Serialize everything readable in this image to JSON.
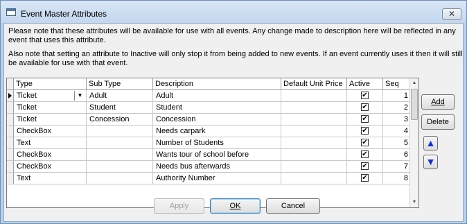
{
  "window": {
    "title": "Event Master Attributes",
    "close_glyph": "✕",
    "icon": "app-window-icon"
  },
  "notes": {
    "line1": "Please note that these attributes will be available for use with all events.  Any change made to description here will be reflected in any event that uses this attribute.",
    "line2": "Also note that setting an attribute to Inactive will only stop it from being added to new events.  If an event currently uses it then it will still be available for use with that event."
  },
  "grid": {
    "columns": {
      "type": "Type",
      "sub_type": "Sub Type",
      "description": "Description",
      "default_unit_price": "Default Unit Price",
      "active": "Active",
      "seq": "Seq"
    },
    "rows": [
      {
        "type": "Ticket",
        "sub_type": "Adult",
        "description": "Adult",
        "price": "",
        "active": true,
        "seq": "1",
        "current": true
      },
      {
        "type": "Ticket",
        "sub_type": "Student",
        "description": "Student",
        "price": "",
        "active": true,
        "seq": "2"
      },
      {
        "type": "Ticket",
        "sub_type": "Concession",
        "description": "Concession",
        "price": "",
        "active": true,
        "seq": "3"
      },
      {
        "type": "CheckBox",
        "sub_type": "",
        "description": "Needs carpark",
        "price": "",
        "active": true,
        "seq": "4"
      },
      {
        "type": "Text",
        "sub_type": "",
        "description": "Number of Students",
        "price": "",
        "active": true,
        "seq": "5"
      },
      {
        "type": "CheckBox",
        "sub_type": "",
        "description": "Wants tour of school before",
        "price": "",
        "active": true,
        "seq": "6"
      },
      {
        "type": "CheckBox",
        "sub_type": "",
        "description": "Needs bus afterwards",
        "price": "",
        "active": true,
        "seq": "7"
      },
      {
        "type": "Text",
        "sub_type": "",
        "description": "Authority Number",
        "price": "",
        "active": true,
        "seq": "8"
      }
    ],
    "combo_glyph": "▼",
    "check_glyph": "✔"
  },
  "side_buttons": {
    "add": "Add",
    "delete": "Delete",
    "up_glyph": "🡅",
    "down_glyph": "🡇"
  },
  "footer": {
    "apply": "Apply",
    "ok": "OK",
    "cancel": "Cancel"
  }
}
